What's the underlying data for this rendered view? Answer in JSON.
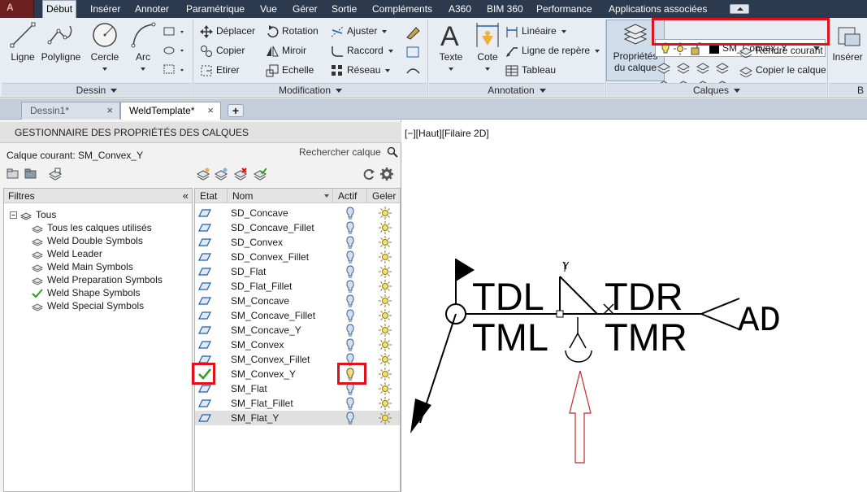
{
  "menubar": {
    "app_letter": "A",
    "tabs": [
      "Début",
      "Insérer",
      "Annoter",
      "Paramétrique",
      "Vue",
      "Gérer",
      "Sortie",
      "Compléments",
      "A360",
      "BIM 360",
      "Performance",
      "Applications associées"
    ],
    "active_tab": "Début"
  },
  "ribbon": {
    "dessin": {
      "title": "Dessin",
      "ligne": "Ligne",
      "polyligne": "Polyligne",
      "cercle": "Cercle",
      "arc": "Arc"
    },
    "modification": {
      "title": "Modification",
      "deplacer": "Déplacer",
      "rotation": "Rotation",
      "ajuster": "Ajuster",
      "copier": "Copier",
      "miroir": "Miroir",
      "raccord": "Raccord",
      "etirer": "Etirer",
      "echelle": "Echelle",
      "reseau": "Réseau"
    },
    "annotation": {
      "title": "Annotation",
      "texte": "Texte",
      "cote": "Cote",
      "lineaire": "Linéaire",
      "ligne_repere": "Ligne de repère",
      "tableau": "Tableau"
    },
    "calques": {
      "title": "Calques",
      "proprietes_line1": "Propriétés",
      "proprietes_line2": "du calque",
      "current_layer": "SM_Convex_Y",
      "rendre_courant": "Rendre courant",
      "copier_calque": "Copier le calque"
    },
    "inserer": {
      "label": "Insérer",
      "next_panel_letter": "B"
    }
  },
  "doc_tabs": [
    {
      "label": "Dessin1*",
      "active": false
    },
    {
      "label": "WeldTemplate*",
      "active": true
    }
  ],
  "new_tab_glyph": "+",
  "lpm": {
    "title": "GESTIONNAIRE DES PROPRIÉTÉS DES CALQUES",
    "current_layer": "Calque courant: SM_Convex_Y",
    "search_placeholder": "Rechercher calque",
    "filters": {
      "header": "Filtres",
      "collapse_glyph": "«",
      "root": "Tous",
      "items": [
        "Tous les calques utilisés",
        "Weld Double Symbols",
        "Weld Leader",
        "Weld Main Symbols",
        "Weld Preparation Symbols",
        "Weld Shape Symbols",
        "Weld Special Symbols"
      ]
    },
    "columns": {
      "etat": "Etat",
      "nom": "Nom",
      "actif": "Actif",
      "geler": "Geler"
    },
    "layers": [
      "SD_Concave",
      "SD_Concave_Fillet",
      "SD_Convex",
      "SD_Convex_Fillet",
      "SD_Flat",
      "SD_Flat_Fillet",
      "SM_Concave",
      "SM_Concave_Fillet",
      "SM_Concave_Y",
      "SM_Convex",
      "SM_Convex_Fillet",
      "SM_Convex_Y",
      "SM_Flat",
      "SM_Flat_Fillet",
      "SM_Flat_Y"
    ],
    "current_index": 11,
    "selected_index": 14
  },
  "drawing": {
    "viewport_label": "[−][Haut][Filaire 2D]",
    "texts": {
      "tdl": "TDL",
      "tdr": "TDR",
      "tml": "TML",
      "tmr": "TMR",
      "ad": "AD",
      "y": "Y"
    }
  },
  "colors": {
    "menubar": "#2b3a4e",
    "highlight": "#e0111a",
    "arrow": "#c0282a",
    "check": "#2e9e1e"
  }
}
